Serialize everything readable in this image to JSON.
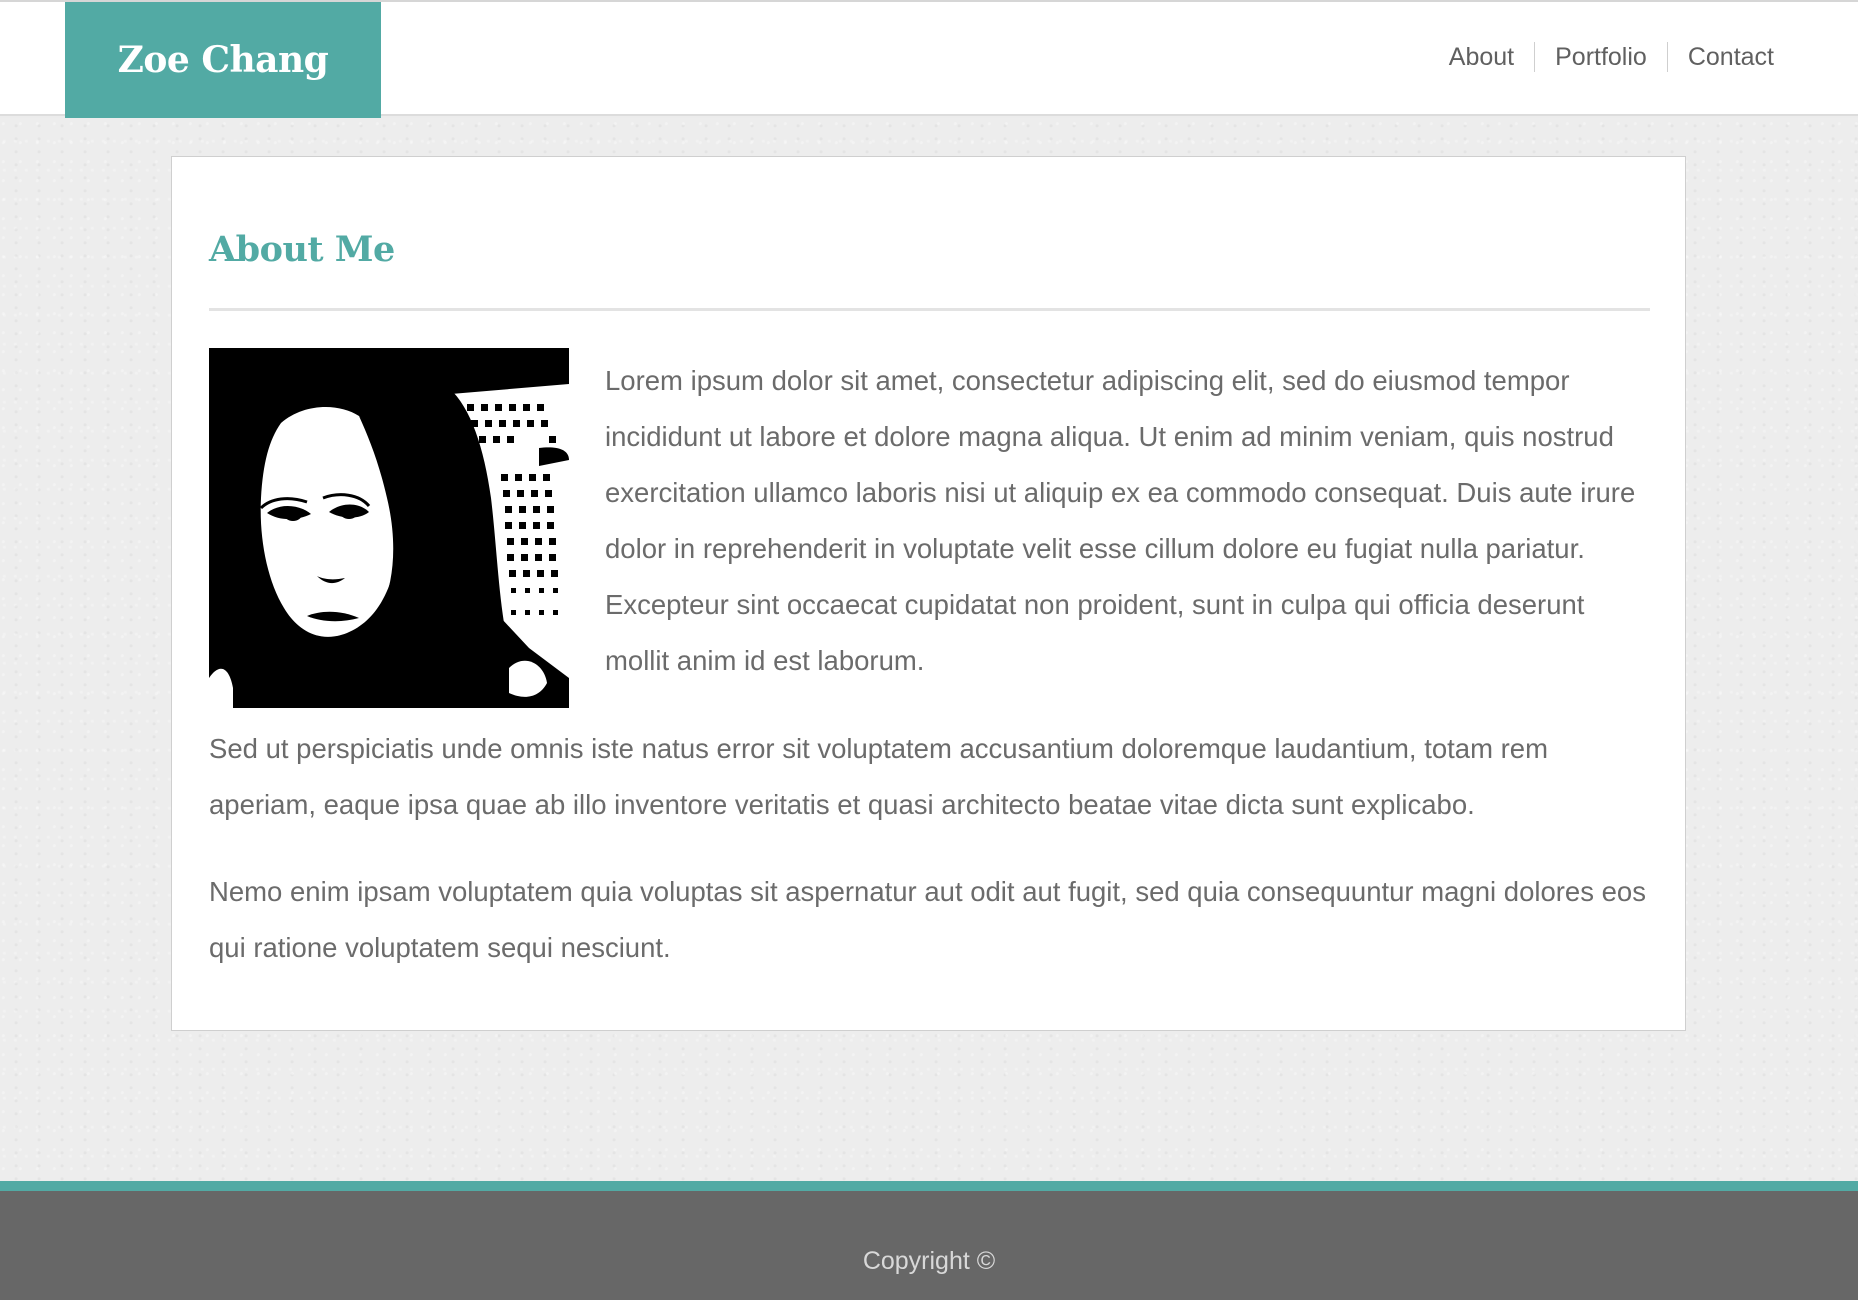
{
  "header": {
    "brand": "Zoe Chang",
    "nav": [
      {
        "label": "About"
      },
      {
        "label": "Portfolio"
      },
      {
        "label": "Contact"
      }
    ]
  },
  "main": {
    "title": "About Me",
    "paragraphs": [
      "Lorem ipsum dolor sit amet, consectetur adipiscing elit, sed do eiusmod tempor incididunt ut labore et dolore magna aliqua. Ut enim ad minim veniam, quis nostrud exercitation ullamco laboris nisi ut aliquip ex ea commodo consequat. Duis aute irure dolor in reprehenderit in voluptate velit esse cillum dolore eu fugiat nulla pariatur. Excepteur sint occaecat cupidatat non proident, sunt in culpa qui officia deserunt mollit anim id est laborum.",
      "Sed ut perspiciatis unde omnis iste natus error sit voluptatem accusantium doloremque laudantium, totam rem aperiam, eaque ipsa quae ab illo inventore veritatis et quasi architecto beatae vitae dicta sunt explicabo.",
      "Nemo enim ipsam voluptatem quia voluptas sit aspernatur aut odit aut fugit, sed quia consequuntur magni dolores eos qui ratione voluptatem sequi nesciunt."
    ],
    "photo": {
      "icon": "portrait-image"
    }
  },
  "footer": {
    "copyright": "Copyright ©"
  },
  "colors": {
    "accent": "#52aaa4",
    "footer_bg": "#676767",
    "page_bg": "#ececec"
  }
}
